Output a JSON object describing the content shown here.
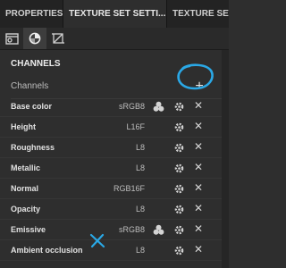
{
  "tabs": [
    {
      "label": "PROPERTIES -..."
    },
    {
      "label": "TEXTURE SET SETTI...",
      "close": "✕"
    },
    {
      "label": "TEXTURE SET ..."
    }
  ],
  "toolbar": {
    "icons": [
      "texture-set-settings-icon",
      "material-icon",
      "uv-crop-icon"
    ]
  },
  "panel": {
    "title": "CHANNELS",
    "header_label": "Channels",
    "add_label": "+"
  },
  "channels": [
    {
      "name": "Base color",
      "format": "sRGB8",
      "has_bullets": true
    },
    {
      "name": "Height",
      "format": "L16F",
      "has_bullets": false
    },
    {
      "name": "Roughness",
      "format": "L8",
      "has_bullets": false
    },
    {
      "name": "Metallic",
      "format": "L8",
      "has_bullets": false
    },
    {
      "name": "Normal",
      "format": "RGB16F",
      "has_bullets": false
    },
    {
      "name": "Opacity",
      "format": "L8",
      "has_bullets": false
    },
    {
      "name": "Emissive",
      "format": "sRGB8",
      "has_bullets": true
    },
    {
      "name": "Ambient occlusion",
      "format": "L8",
      "has_bullets": false
    }
  ],
  "row_remove": "✕",
  "colors": {
    "annotation": "#2aa8e6",
    "panel_bg": "#2e2e2e",
    "tabbar_bg": "#232323"
  }
}
